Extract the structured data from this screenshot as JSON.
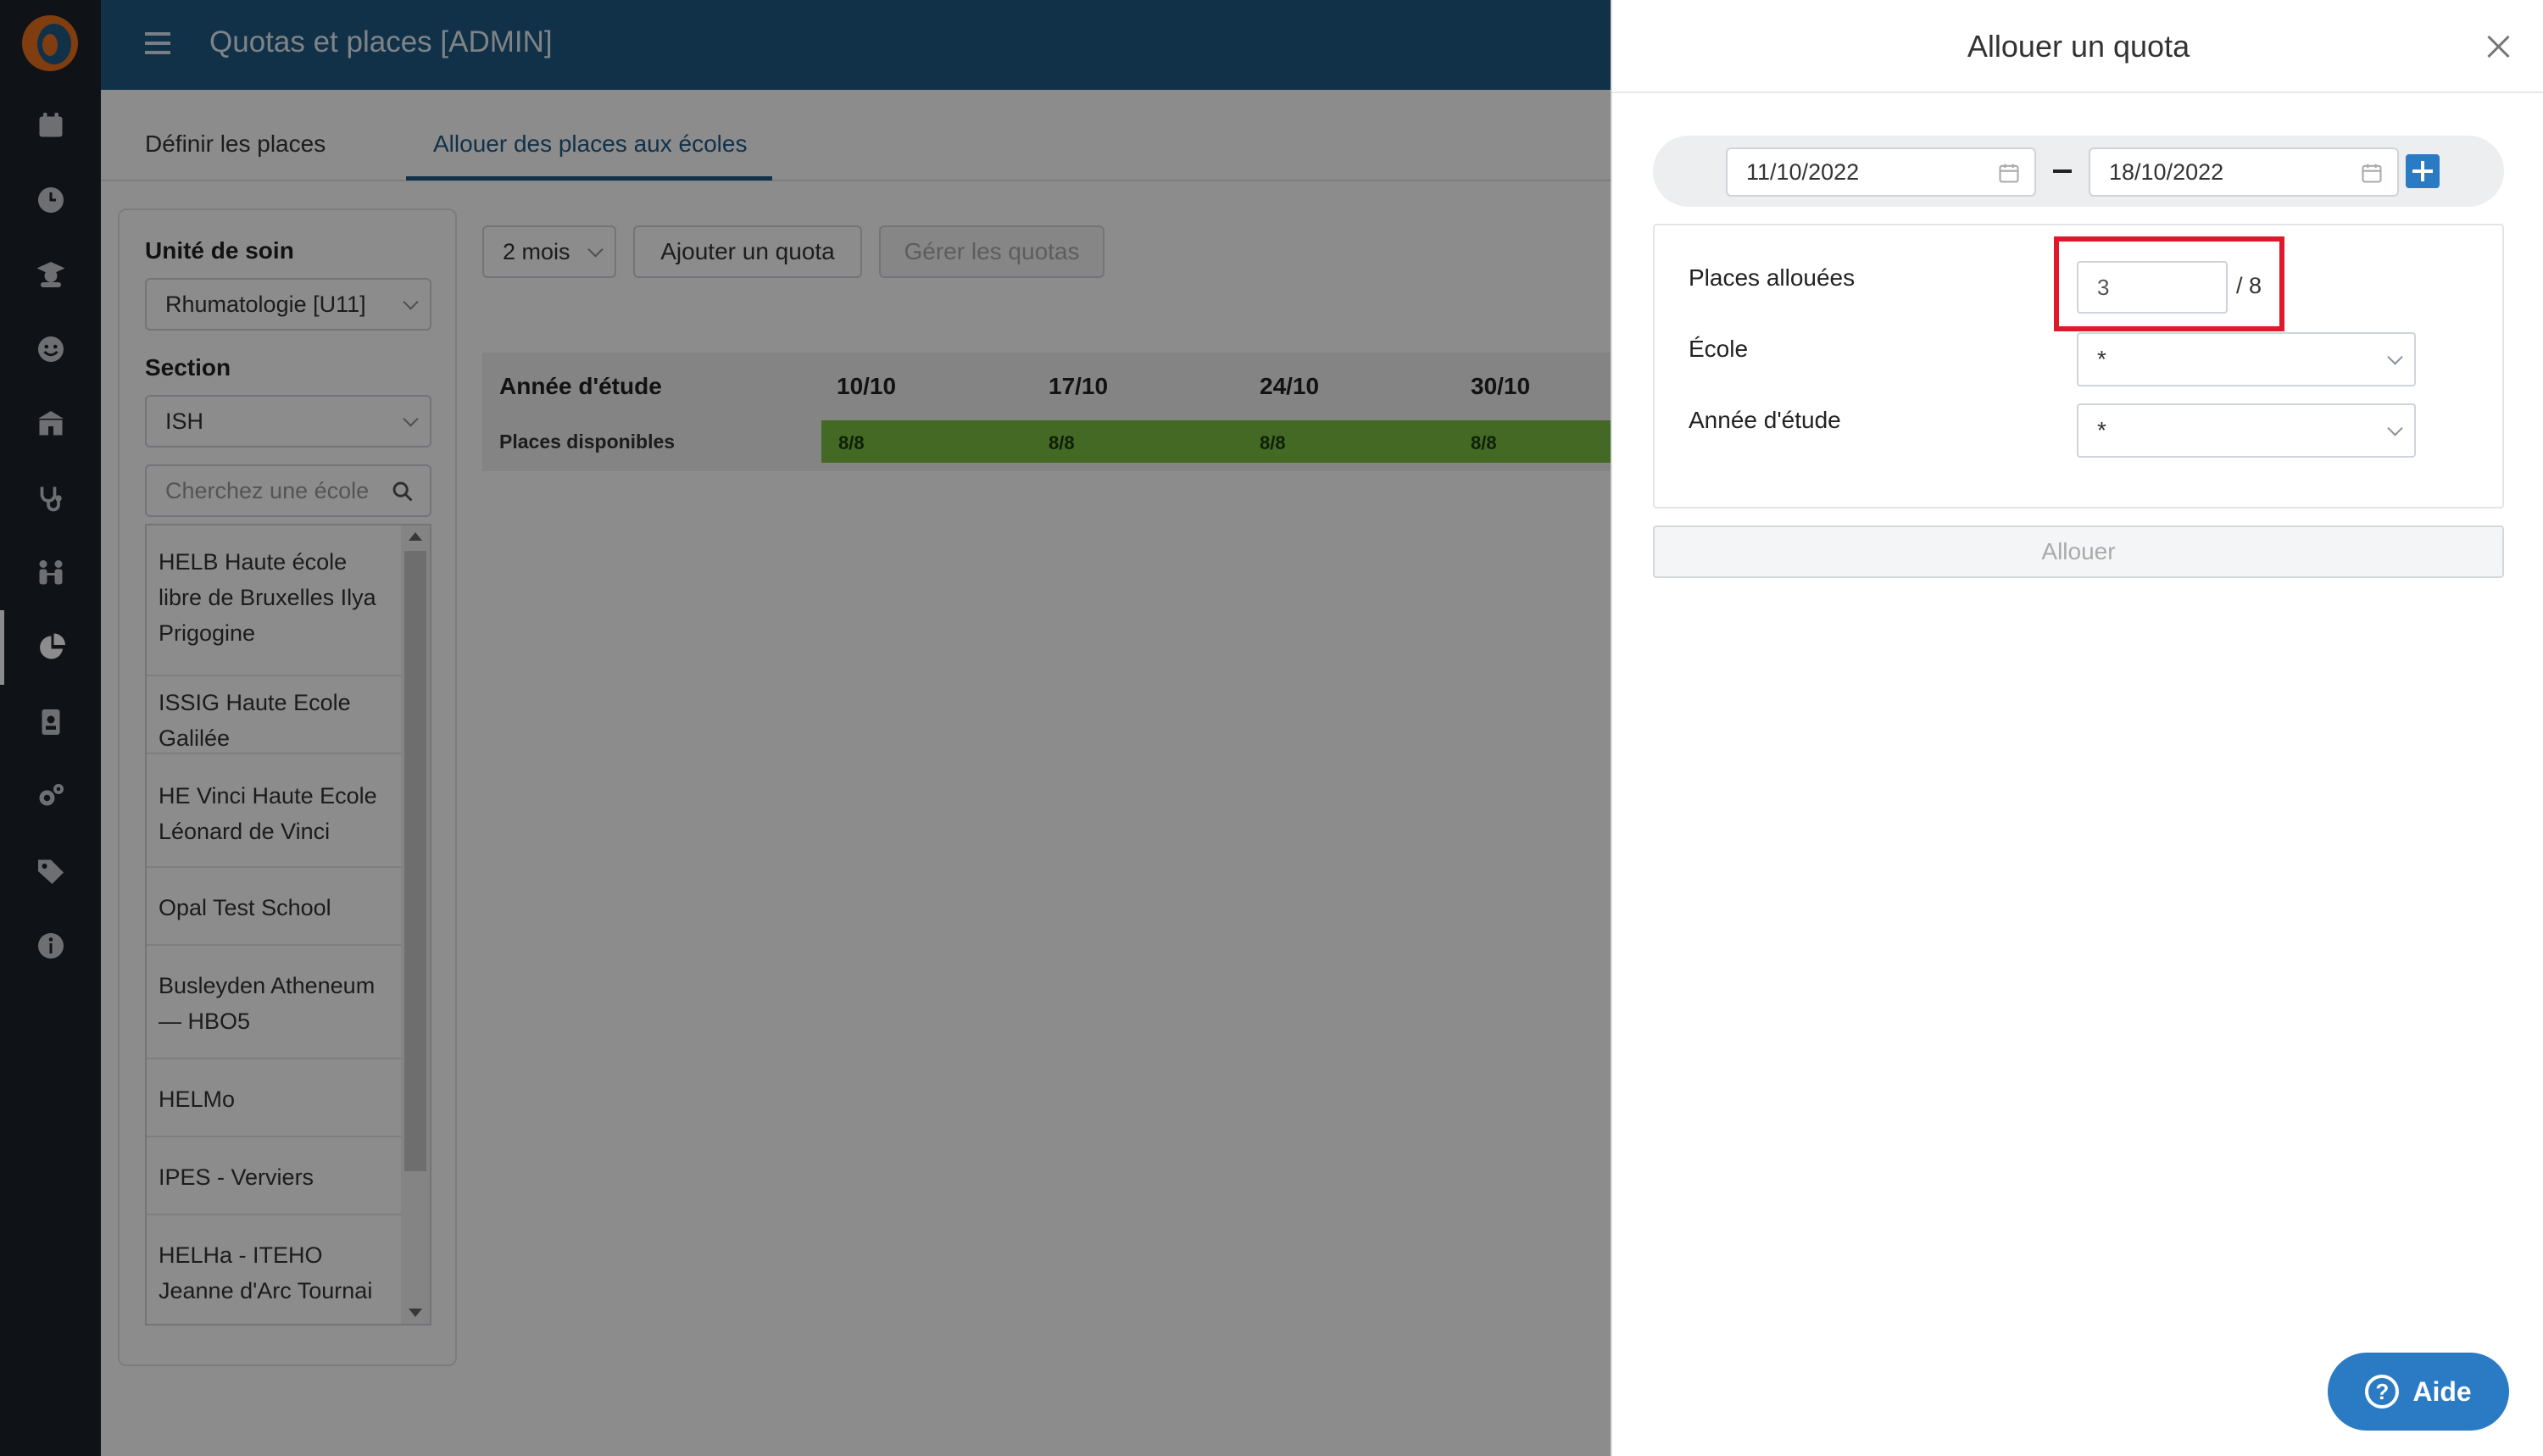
{
  "header": {
    "title": "Quotas et places [ADMIN]"
  },
  "rail": {
    "icons": [
      "calendar-icon",
      "clock-icon",
      "graduate-icon",
      "smiley-icon",
      "school-icon",
      "stethoscope-icon",
      "people-icon",
      "pie-chart-icon",
      "badge-icon",
      "gears-icon",
      "tags-icon",
      "info-icon"
    ]
  },
  "tabs": [
    {
      "label": "Définir les places"
    },
    {
      "label": "Allouer des places aux écoles"
    }
  ],
  "filters": {
    "unit_label": "Unité de soin",
    "unit_value": "Rhumatologie [U11]",
    "section_label": "Section",
    "section_value": "ISH",
    "search_placeholder": "Cherchez une école"
  },
  "schools": [
    "HELB Haute école libre de Bruxelles Ilya Prigogine",
    "ISSIG Haute Ecole Galilée",
    "HE Vinci Haute Ecole Léonard de Vinci",
    "Opal Test School",
    "Busleyden Atheneum — HBO5",
    "HELMo",
    "IPES - Verviers",
    "HELHa - ITEHO Jeanne d'Arc Tournai"
  ],
  "toolbar": {
    "period": "2 mois",
    "add_quota": "Ajouter un quota",
    "manage_quotas": "Gérer les quotas"
  },
  "grid": {
    "row_header": "Année d'étude",
    "weeks": [
      "10/10",
      "17/10",
      "24/10",
      "30/10"
    ],
    "row_label": "Places disponibles",
    "availability": [
      "8/8",
      "8/8",
      "8/8",
      "8/8"
    ]
  },
  "drawer": {
    "title": "Allouer un quota",
    "date_from": "11/10/2022",
    "date_to": "18/10/2022",
    "places_label": "Places allouées",
    "places_value": "3",
    "places_total": "/ 8",
    "school_label": "École",
    "school_value": "*",
    "year_label": "Année d'étude",
    "year_value": "*",
    "submit": "Allouer"
  },
  "help": {
    "label": "Aide"
  },
  "colors": {
    "header": "#1f5a85",
    "rail": "#1c2229",
    "accent": "#2a7bc4",
    "available": "#7cbf42",
    "highlight": "#e0182b"
  }
}
